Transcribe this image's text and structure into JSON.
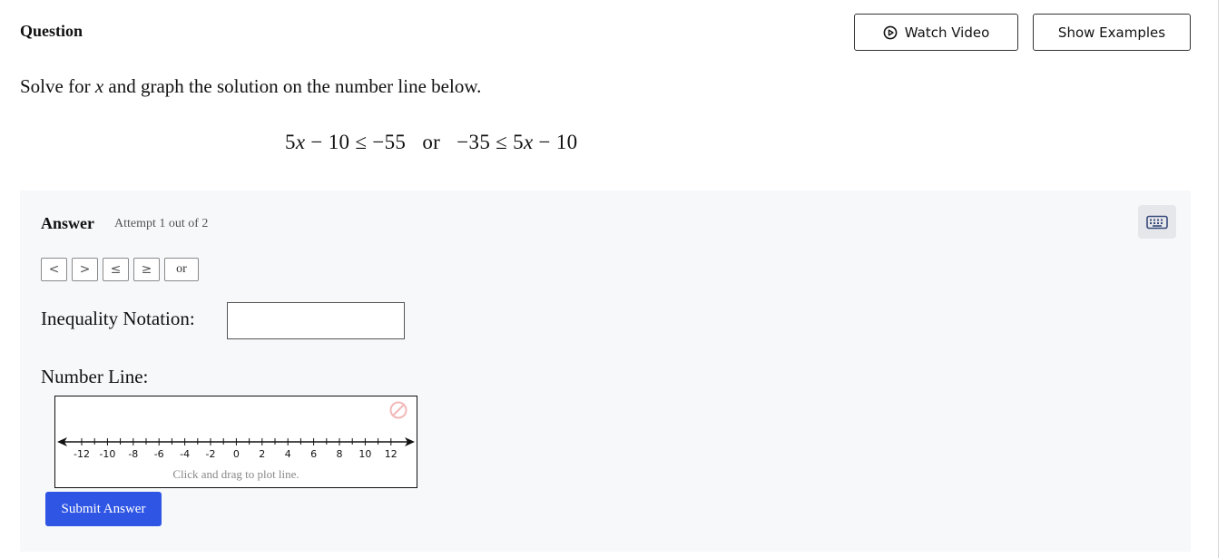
{
  "header": {
    "title": "Question",
    "watch_video_label": "Watch Video",
    "show_examples_label": "Show Examples"
  },
  "question": {
    "prompt_before": "Solve for ",
    "variable": "x",
    "prompt_after": " and graph the solution on the number line below.",
    "equation": {
      "left_coef": "5",
      "left_rest": " − 10 ≤ −55   or   −35 ≤ 5",
      "right_rest": " − 10"
    }
  },
  "answer": {
    "label": "Answer",
    "attempt": "Attempt 1 out of 2",
    "symbols": [
      "<",
      ">",
      "≤",
      "≥",
      "or"
    ],
    "inequality_label": "Inequality Notation:",
    "inequality_value": "",
    "number_line_label": "Number Line:",
    "number_line": {
      "min": -13,
      "max": 13,
      "tick_labels": [
        "-12",
        "-10",
        "-8",
        "-6",
        "-4",
        "-2",
        "0",
        "2",
        "4",
        "6",
        "8",
        "10",
        "12"
      ],
      "hint": "Click and drag to plot line."
    },
    "submit_label": "Submit Answer"
  },
  "colors": {
    "primary": "#2f55e4",
    "panel_bg": "#f7f8fa",
    "clear_icon": "#f2b8b8"
  },
  "icons": [
    "play-circle-icon",
    "keyboard-icon",
    "clear-prohibited-icon"
  ]
}
